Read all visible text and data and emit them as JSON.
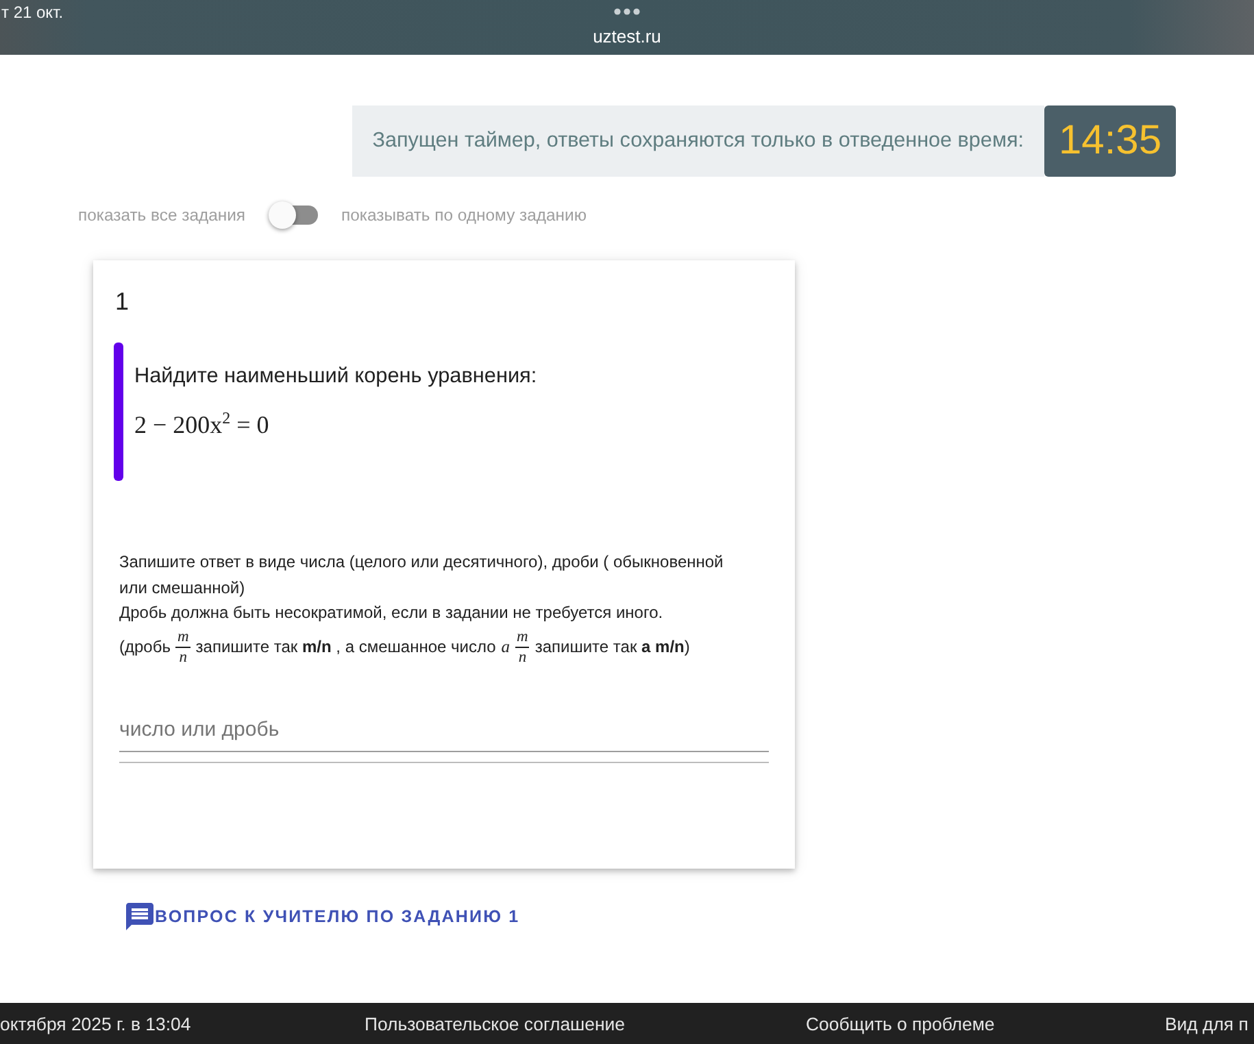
{
  "status_bar": {
    "date": "т 21 окт.",
    "address": "uztest.ru"
  },
  "timer": {
    "message": "Запущен таймер, ответы сохраняются только в отведенное время:",
    "time": "14:35"
  },
  "view_toggle": {
    "left_label": "показать все задания",
    "on": false,
    "right_label": "показывать по одному заданию"
  },
  "task": {
    "number": "1",
    "question": "Найдите наименьший корень уравнения:",
    "equation": "2 − 200x$^{2}$ = 0",
    "instructions": [
      {
        "kind": "text",
        "text": "Запишите ответ в виде числа (целого или десятичного), дроби ( обыкновенной или смешанной)"
      },
      {
        "kind": "text",
        "text": "Дробь должна быть несократимой, если в задании не требуется иного."
      },
      {
        "kind": "formula_line",
        "parts": [
          {
            "kind": "text",
            "text": "(дробь"
          },
          {
            "kind": "fraction",
            "numerator": "m",
            "denominator": "n"
          },
          {
            "kind": "text",
            "text": "запишите так **m/n** , а смешанное число"
          },
          {
            "kind": "mixed_number",
            "whole": "a",
            "numerator": "m",
            "denominator": "n"
          },
          {
            "kind": "text",
            "text": "запишите так **a m/n**)"
          }
        ]
      }
    ],
    "answer": {
      "placeholder": "число или дробь"
    }
  },
  "ask_teacher": {
    "label": "ВОПРОС К УЧИТЕЛЮ ПО ЗАДАНИЮ 1"
  },
  "footer": {
    "timestamp": "октября 2025 г. в 13:04",
    "links": [
      "Пользовательское соглашение",
      "Сообщить о проблеме",
      "Вид для п"
    ]
  }
}
